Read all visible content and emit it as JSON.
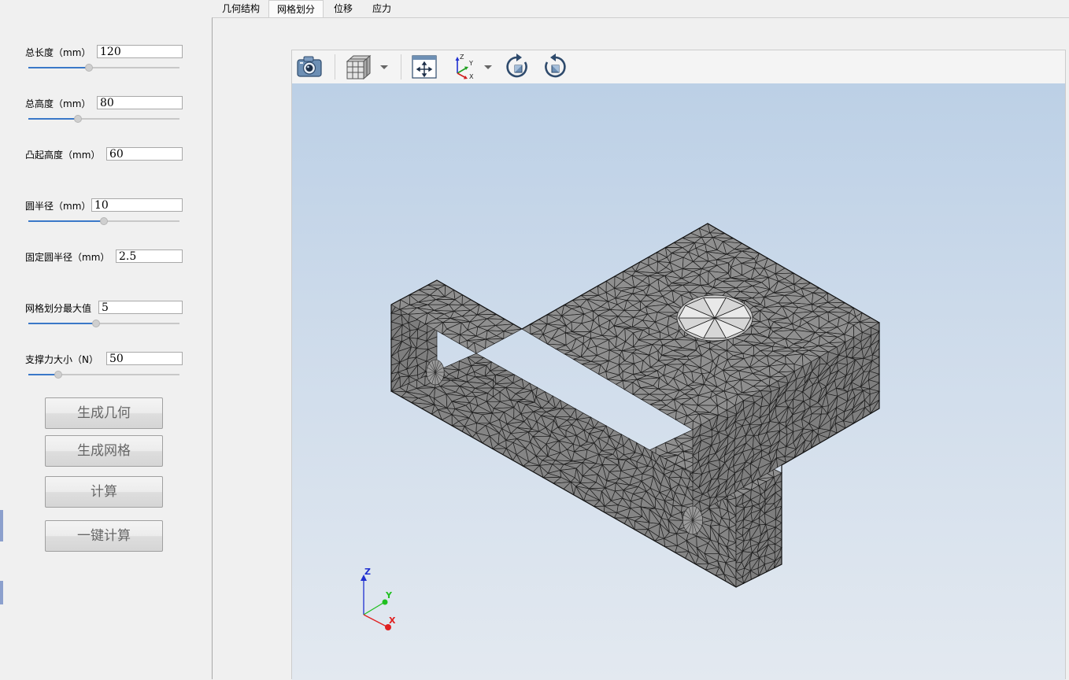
{
  "tabs": [
    {
      "label": "几何结构"
    },
    {
      "label": "网格划分"
    },
    {
      "label": "位移"
    },
    {
      "label": "应力"
    }
  ],
  "active_tab": "网格划分",
  "params": {
    "total_length": {
      "label": "总长度（mm）",
      "value": "120",
      "slider_fraction": 0.4
    },
    "total_height": {
      "label": "总高度（mm）",
      "value": "80",
      "slider_fraction": 0.33
    },
    "boss_height": {
      "label": "凸起高度（mm）",
      "value": "60"
    },
    "circle_radius": {
      "label": "圆半径（mm）",
      "value": "10",
      "slider_fraction": 0.5
    },
    "fixed_circle_radius": {
      "label": "固定圆半径（mm）",
      "value": "2.5"
    },
    "mesh_max": {
      "label": "网格划分最大值",
      "value": "5",
      "slider_fraction": 0.45
    },
    "support_force": {
      "label": "支撑力大小（N）",
      "value": "50",
      "slider_fraction": 0.2
    }
  },
  "buttons": {
    "generate_geometry": "生成几何",
    "generate_mesh": "生成网格",
    "compute": "计算",
    "one_click_compute": "一键计算"
  },
  "viewer": {
    "toolbar": [
      {
        "icon": "camera-icon"
      },
      {
        "icon": "view-cube-icon",
        "dropdown": true
      },
      {
        "icon": "fit-all-icon"
      },
      {
        "icon": "axis-orientation-icon",
        "dropdown": true
      },
      {
        "icon": "rotate-clockwise-icon"
      },
      {
        "icon": "rotate-counterclockwise-icon"
      }
    ],
    "triad": {
      "x": "X",
      "y": "Y",
      "z": "Z"
    },
    "colors": {
      "mesh_fill": "#8c8c8c",
      "mesh_line": "#1e1e1e",
      "bg_top": "#bcd0e6",
      "bg_bottom": "#e3e9f0",
      "axis_x": "#e02020",
      "axis_y": "#20c020",
      "axis_z": "#2030d0"
    }
  }
}
